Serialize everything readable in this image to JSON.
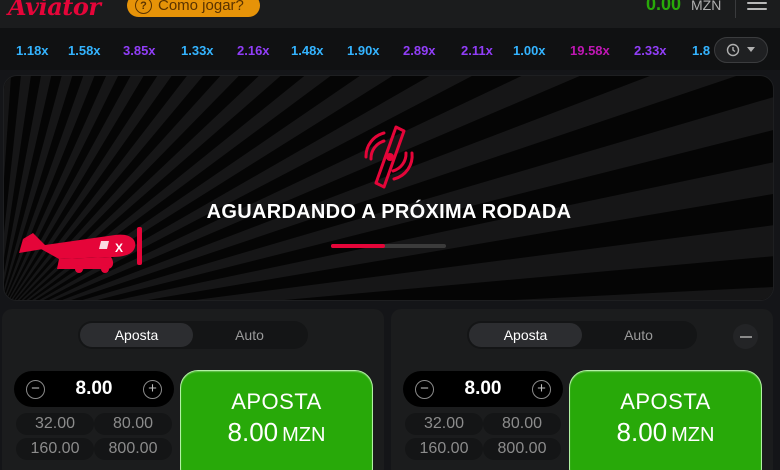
{
  "header": {
    "logo": "Aviator",
    "how_to_play": "Como jogar?",
    "balance": "0.00",
    "currency": "MZN"
  },
  "multipliers": [
    {
      "value": "1.18x",
      "color": "#34b4ff"
    },
    {
      "value": "1.58x",
      "color": "#34b4ff"
    },
    {
      "value": "3.85x",
      "color": "#913ef8"
    },
    {
      "value": "1.33x",
      "color": "#34b4ff"
    },
    {
      "value": "2.16x",
      "color": "#913ef8"
    },
    {
      "value": "1.48x",
      "color": "#34b4ff"
    },
    {
      "value": "1.90x",
      "color": "#34b4ff"
    },
    {
      "value": "2.89x",
      "color": "#913ef8"
    },
    {
      "value": "2.11x",
      "color": "#913ef8"
    },
    {
      "value": "1.00x",
      "color": "#34b4ff"
    },
    {
      "value": "19.58x",
      "color": "#c017b4"
    },
    {
      "value": "2.33x",
      "color": "#913ef8"
    },
    {
      "value": "1.8",
      "color": "#34b4ff"
    }
  ],
  "game": {
    "status_text": "AGUARDANDO A PRÓXIMA RODADA",
    "progress": 0.47,
    "accent_color": "#e50539"
  },
  "bet_panels": [
    {
      "tabs": [
        "Aposta",
        "Auto"
      ],
      "amount": "8.00",
      "quick_amounts": [
        "32.00",
        "80.00",
        "160.00",
        "800.00"
      ],
      "button_label": "APOSTA",
      "button_amount": "8.00",
      "button_currency": "MZN"
    },
    {
      "tabs": [
        "Aposta",
        "Auto"
      ],
      "amount": "8.00",
      "quick_amounts": [
        "32.00",
        "80.00",
        "160.00",
        "800.00"
      ],
      "button_label": "APOSTA",
      "button_amount": "8.00",
      "button_currency": "MZN"
    }
  ],
  "colors": {
    "brand": "#e50539",
    "bet_green": "#28a909",
    "balance_green": "#28a909",
    "how_to_play_bg": "#e69308"
  }
}
